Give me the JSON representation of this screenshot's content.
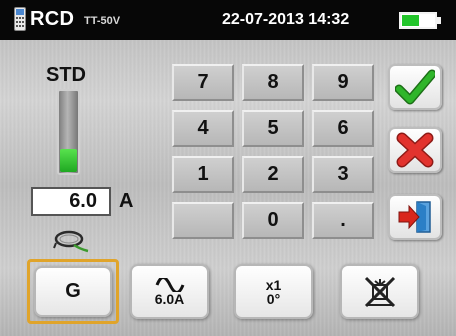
{
  "header": {
    "title": "RCD",
    "subtitle": "TT-50V",
    "datetime": "22-07-2013 14:32",
    "battery_level": 0.5,
    "battery_color": "#22c52a",
    "meter_icon": "meter-icon"
  },
  "left": {
    "std_label": "STD",
    "level_fraction": 0.3,
    "level_color": "#36c92f",
    "current_value": "6.0",
    "current_unit": "A",
    "clamp_icon": "clamp-icon"
  },
  "keypad": {
    "keys": [
      "7",
      "8",
      "9",
      "4",
      "5",
      "6",
      "1",
      "2",
      "3",
      "",
      "0",
      "."
    ]
  },
  "side_buttons": {
    "confirm_icon": "check-icon",
    "cancel_icon": "x-icon",
    "exit_icon": "exit-icon",
    "confirm_color": "#2fb52a",
    "cancel_color": "#e2332e",
    "exit_color": "#d9261c"
  },
  "bottom": {
    "g_label": "G",
    "wave_icon": "sine-wave-icon",
    "wave_label": "6.0A",
    "mult_label": "x1",
    "angle_label": "0°",
    "disabled_icon": "disabled-icon",
    "selected_color": "#e0a42a"
  }
}
